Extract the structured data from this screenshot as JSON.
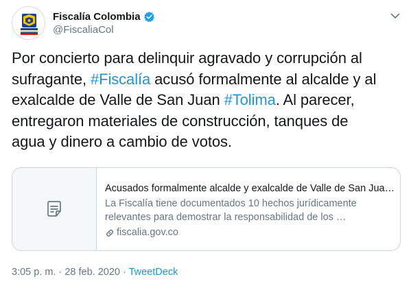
{
  "author": {
    "display_name": "Fiscalía Colombia",
    "handle": "@FiscaliaCol",
    "avatar_icon": "fiscalia-logo",
    "verified_icon": "verified-badge-icon"
  },
  "tweet": {
    "line1": "Por concierto para delinquir agravado y corrupción al",
    "line2_pre": "sufragante, ",
    "hashtag1": "#Fiscalía",
    "line2_post": " acusó formalmente al alcalde y al",
    "line3_pre": "exalcalde de Valle de San Juan ",
    "hashtag2": "#Tolima",
    "line3_post": ". Al parecer,",
    "line4": "entregaron materiales de construcción, tanques de",
    "line5": "agua y dinero a cambio de votos."
  },
  "card": {
    "thumb_icon": "document-icon",
    "title": "Acusados formalmente alcalde y exalcalde de Valle de San Jua…",
    "desc_line1": "La Fiscalía tiene documentados 10 hechos jurídicamente",
    "desc_line2": "relevantes para demostrar la responsabilidad de los …",
    "link_icon": "link-icon",
    "domain": "fiscalia.gov.co"
  },
  "meta": {
    "time_date": "3:05 p. m. · 28 feb. 2020 · ",
    "source": "TweetDeck"
  },
  "menu": {
    "icon": "chevron-down-icon"
  },
  "colors": {
    "link": "#1b95e0",
    "secondary": "#657786",
    "border": "#ccd6dd",
    "text": "#14171a"
  }
}
